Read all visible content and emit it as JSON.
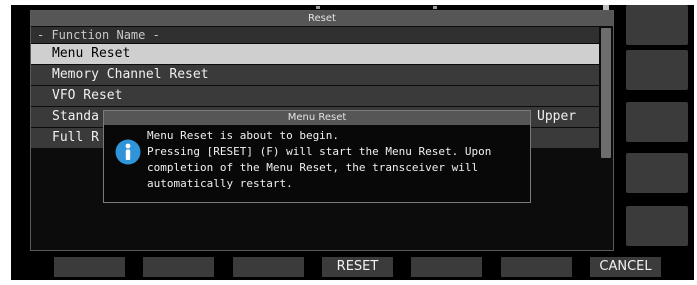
{
  "window": {
    "title": "Reset"
  },
  "list": {
    "column_header": "- Function Name -",
    "rows": [
      {
        "label": "Menu Reset",
        "value": ""
      },
      {
        "label": "Memory Channel Reset",
        "value": ""
      },
      {
        "label": "VFO Reset",
        "value": ""
      },
      {
        "label": "Standa",
        "value": "Upper ..."
      },
      {
        "label": "Full R",
        "value": ""
      }
    ]
  },
  "dialog": {
    "title": "Menu Reset",
    "icon": "info-icon",
    "lines": [
      "Menu Reset is about to begin.",
      "Pressing [RESET] (F) will start the Menu Reset. Upon",
      "completion of the Menu Reset, the transceiver will",
      "automatically restart."
    ]
  },
  "function_keys": {
    "f1": "",
    "f2": "",
    "f3": "",
    "f4": "RESET",
    "f5": "",
    "f6": "",
    "f7": "CANCEL"
  },
  "colors": {
    "background": "#000000",
    "selected_row": "#cfcfcf",
    "title_bar": "#565656",
    "key": "#3b3b3b",
    "info_icon": "#2f95d8"
  }
}
